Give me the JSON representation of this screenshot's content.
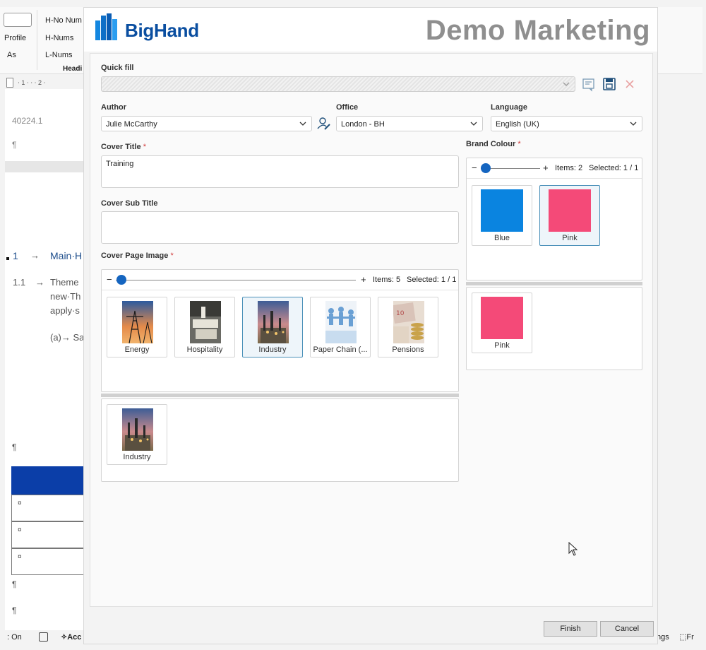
{
  "background_doc": {
    "ribbon": {
      "profile": "Profile",
      "as": "As",
      "h_no_num": "H-No Num",
      "h_nums": "H-Nums",
      "l_nums": "L-Nums",
      "heading_group": "Headi"
    },
    "ruler": "⋅ 1 ⋅ ⋅ ⋅ 2 ⋅",
    "doc_id": "40224.1",
    "para_mark": "¶",
    "heading_num": "1",
    "arrow": "→",
    "heading_text": "Main·H",
    "sub_num": "1.1",
    "body_line1": "Theme",
    "body_line2": "new·Th",
    "body_line3": "apply·s",
    "item_a": "(a)→ Sa",
    "cell_mark": "¤",
    "status_left": "On",
    "status_acc": "Acc",
    "status_right": "ngs",
    "status_far": "Fr"
  },
  "dialog": {
    "logo_text": "BigHand",
    "brand_title": "Demo Marketing",
    "quick_fill": {
      "label": "Quick fill",
      "value": ""
    },
    "author": {
      "label": "Author",
      "value": "Julie McCarthy"
    },
    "office": {
      "label": "Office",
      "value": "London - BH"
    },
    "language": {
      "label": "Language",
      "value": "English (UK)"
    },
    "cover_title": {
      "label": "Cover Title",
      "required": "*",
      "value": "Training"
    },
    "cover_sub_title": {
      "label": "Cover Sub Title",
      "value": ""
    },
    "cover_page_image": {
      "label": "Cover Page Image",
      "required": "*",
      "minus": "−",
      "plus": "+",
      "items_text": "Items: 5",
      "selected_text": "Selected: 1 / 1",
      "items": [
        {
          "label": "Energy",
          "selected": false
        },
        {
          "label": "Hospitality",
          "selected": false
        },
        {
          "label": "Industry",
          "selected": true
        },
        {
          "label": "Paper Chain (...",
          "selected": false
        },
        {
          "label": "Pensions",
          "selected": false
        }
      ],
      "selected_items": [
        {
          "label": "Industry"
        }
      ]
    },
    "brand_colour": {
      "label": "Brand Colour",
      "required": "*",
      "minus": "−",
      "plus": "+",
      "items_text": "Items: 2",
      "selected_text": "Selected: 1 / 1",
      "items": [
        {
          "label": "Blue",
          "color": "#0a84e0",
          "selected": false
        },
        {
          "label": "Pink",
          "color": "#f44a78",
          "selected": true
        }
      ],
      "selected_items": [
        {
          "label": "Pink",
          "color": "#f44a78"
        }
      ]
    },
    "buttons": {
      "finish": "Finish",
      "cancel": "Cancel"
    }
  }
}
